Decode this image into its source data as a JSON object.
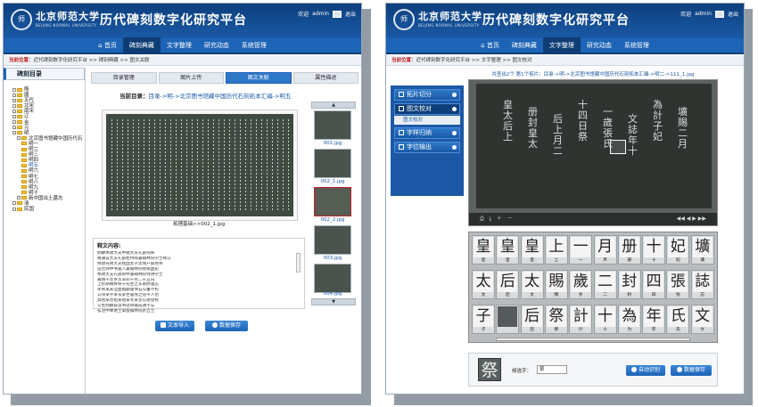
{
  "header": {
    "logo_char": "师",
    "university": "北京师范大学",
    "university_en": "BEIJING NORMAL UNIVERSITY",
    "title": "历代碑刻数字化研究平台",
    "welcome": "欢迎",
    "user": "admin",
    "logout": "退出"
  },
  "nav": [
    "首页",
    "碑刻典藏",
    "文字整理",
    "研究动态",
    "系统管理"
  ],
  "left": {
    "crumb_label": "当前位置：",
    "crumb_path": "近代碑刻数字化研究平台 >> 碑刻典藏 >> 图文关联",
    "side_title": "碑刻目录",
    "tree": [
      "隋",
      "唐",
      "五代",
      "北宋",
      "南宋",
      "辽",
      "金",
      "元",
      "明",
      "北京图书馆藏中国历代石",
      "明一",
      "明二",
      "明三",
      "明四",
      "明五",
      "明六",
      "明七",
      "明八",
      "明九",
      "明十",
      "新中国出土墓志",
      "清",
      "民国"
    ],
    "tabs": [
      "目录管理",
      "图片上传",
      "图文关联",
      "属性描述"
    ],
    "current_label": "当前目录：",
    "current_path": "目录->明->北京图书馆藏中国历代石刻拓本汇编->明五",
    "rubbing_caption": "拓理基础>>002_1.jpg",
    "thumbs": [
      "001.jpg",
      "002_1.jpg",
      "002_2.jpg",
      "003.jpg",
      "004.jpg"
    ],
    "shiwen_title": "释文内容:",
    "shiwen_lines": [
      "明故奉政大夫中顺大夫礼部祠祭",
      "赠通议大夫礼部右侍郎兼翰林院学士韩公",
      "特进光禄大夫柱国太子太保户部尚书",
      "征仕郎中书舍人兼翰林院修撰国史",
      "奉政大夫礼部郎中兼翰林院侍讲学士",
      "嘉靖十年岁次辛卯十月二十五日",
      "上钦命赐葬祭于先茔之东南原谨志",
      "孝男某某泣血稽颡谨书石以垂不朽",
      "公讳某字某号某世居燕之宛平人也",
      "高祖某曾祖某祖某考某皆以德望称",
      "公生而颖异读书过目辄成诵不忘",
      "弘治中举进士第授翰林院庶吉士"
    ],
    "btn_import": "文本导入",
    "btn_save": "数据保存"
  },
  "right": {
    "crumb_label": "当前位置：",
    "crumb_path": "近代碑刻数字化研究平台 >> 文字整理 >> 图文校对",
    "menu": [
      "拓片切分",
      "图文校对",
      "字样归纳",
      "字位输出"
    ],
    "submenu": "图文校对",
    "image_header": "共查出2个 第1个拓片：目录->明->北京图书馆藏中国历代石刻拓本汇编->明二->111_1.jpg",
    "glyph_rows": [
      [
        "皇",
        "皇",
        "皇",
        "上",
        "一",
        "月",
        "册",
        "十",
        "妃",
        "壙"
      ],
      [
        "太",
        "后",
        "太",
        "賜",
        "歲",
        "二",
        "封",
        "四",
        "張",
        "誌"
      ],
      [
        "子",
        "",
        "后",
        "祭",
        "計",
        "十",
        "為",
        "年",
        "氏",
        "文"
      ]
    ],
    "glyph_labels": [
      [
        "皇",
        "皇",
        "皇",
        "上",
        "一",
        "月",
        "册",
        "十",
        "妃",
        "壙"
      ],
      [
        "太",
        "后",
        "太",
        "赐",
        "岁",
        "二",
        "封",
        "四",
        "张",
        "志"
      ],
      [
        "子",
        "",
        "后",
        "祭",
        "计",
        "十",
        "为",
        "年",
        "氏",
        "文"
      ]
    ],
    "selected_char": "祭",
    "candidate_label": "候选字：",
    "candidate_value": "祭",
    "btn_auto": "自动识别",
    "btn_save": "数据保存"
  }
}
